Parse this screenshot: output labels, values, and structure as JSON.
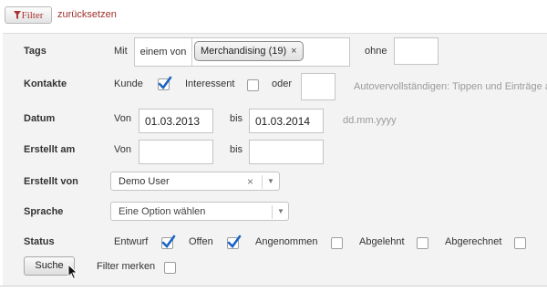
{
  "toolbar": {
    "filter_label": "Filter",
    "reset_label": "zurücksetzen"
  },
  "form": {
    "tags": {
      "label": "Tags",
      "mit_label": "Mit",
      "mode_value": "einem von",
      "selected_tags": [
        {
          "label": "Merchandising (19)",
          "remove": "×"
        }
      ],
      "ohne_label": "ohne",
      "ohne_value": ""
    },
    "kontakte": {
      "label": "Kontakte",
      "kunde_label": "Kunde",
      "kunde_checked": true,
      "interessent_label": "Interessent",
      "interessent_checked": false,
      "oder_label": "oder",
      "oder_value": "",
      "autocomplete_hint": "Autovervollständigen: Tippen und Einträge a"
    },
    "datum": {
      "label": "Datum",
      "von_label": "Von",
      "von_value": "01.03.2013",
      "bis_label": "bis",
      "bis_value": "01.03.2014",
      "format_hint": "dd.mm.yyyy"
    },
    "erstellt_am": {
      "label": "Erstellt am",
      "von_label": "Von",
      "von_value": "",
      "bis_label": "bis",
      "bis_value": ""
    },
    "erstellt_von": {
      "label": "Erstellt von",
      "selected": "Demo User",
      "clear": "×"
    },
    "sprache": {
      "label": "Sprache",
      "placeholder": "Eine Option wählen"
    },
    "status": {
      "label": "Status",
      "options": [
        {
          "label": "Entwurf",
          "checked": true
        },
        {
          "label": "Offen",
          "checked": true
        },
        {
          "label": "Angenommen",
          "checked": false
        },
        {
          "label": "Abgelehnt",
          "checked": false
        },
        {
          "label": "Abgerechnet",
          "checked": false
        }
      ]
    },
    "search_label": "Suche",
    "remember_label": "Filter merken",
    "remember_checked": false
  },
  "colors": {
    "accent_red": "#a0302b",
    "check_blue": "#1c64c4",
    "panel_bg": "#f3f3f3"
  },
  "icons": {
    "filter": "funnel-icon",
    "check": "checkmark-icon",
    "dropdown": "chevron-down-icon",
    "cursor": "mouse-pointer-icon"
  }
}
